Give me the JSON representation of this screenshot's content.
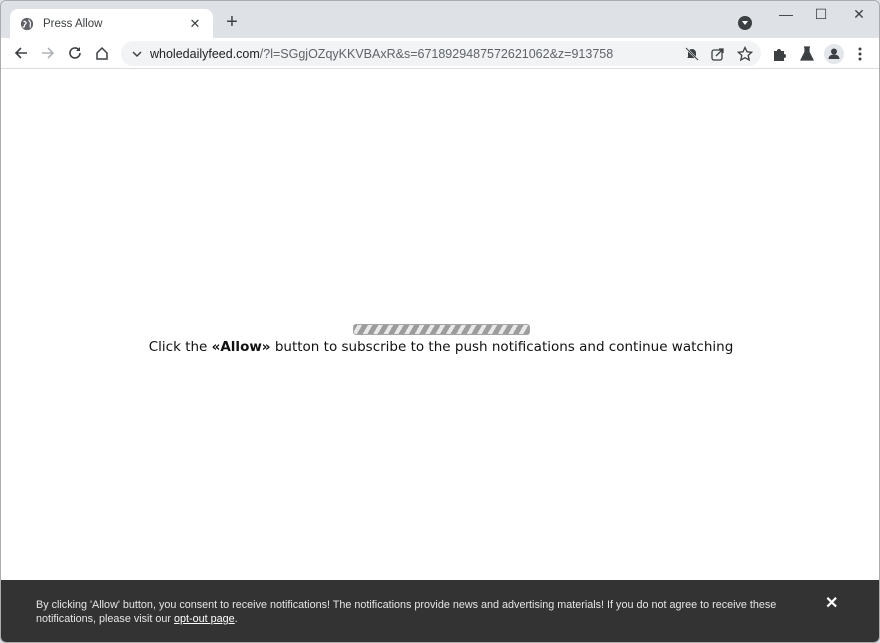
{
  "browser": {
    "tab": {
      "title": "Press Allow",
      "close": "✕",
      "icon": "globe-icon"
    },
    "new_tab": "+",
    "window_controls": {
      "minimize": "—",
      "maximize": "☐",
      "close": "✕"
    },
    "address_bar": {
      "domain": "wholedailyfeed.com",
      "path": "/?l=SGgjOZqyKKVBAxR&s=6718929487572621062&z=913758"
    }
  },
  "page": {
    "loading_progress": "indeterminate",
    "message": {
      "before": "Click the ",
      "bold": "«Allow»",
      "after": " button to subscribe to the push notifications and continue watching"
    }
  },
  "consent_banner": {
    "text": "By clicking 'Allow' button, you consent to receive notifications! The notifications provide news and advertising materials! If you do not agree to receive these notifications, please visit our ",
    "link": "opt-out page",
    "suffix": ".",
    "close": "✕"
  }
}
